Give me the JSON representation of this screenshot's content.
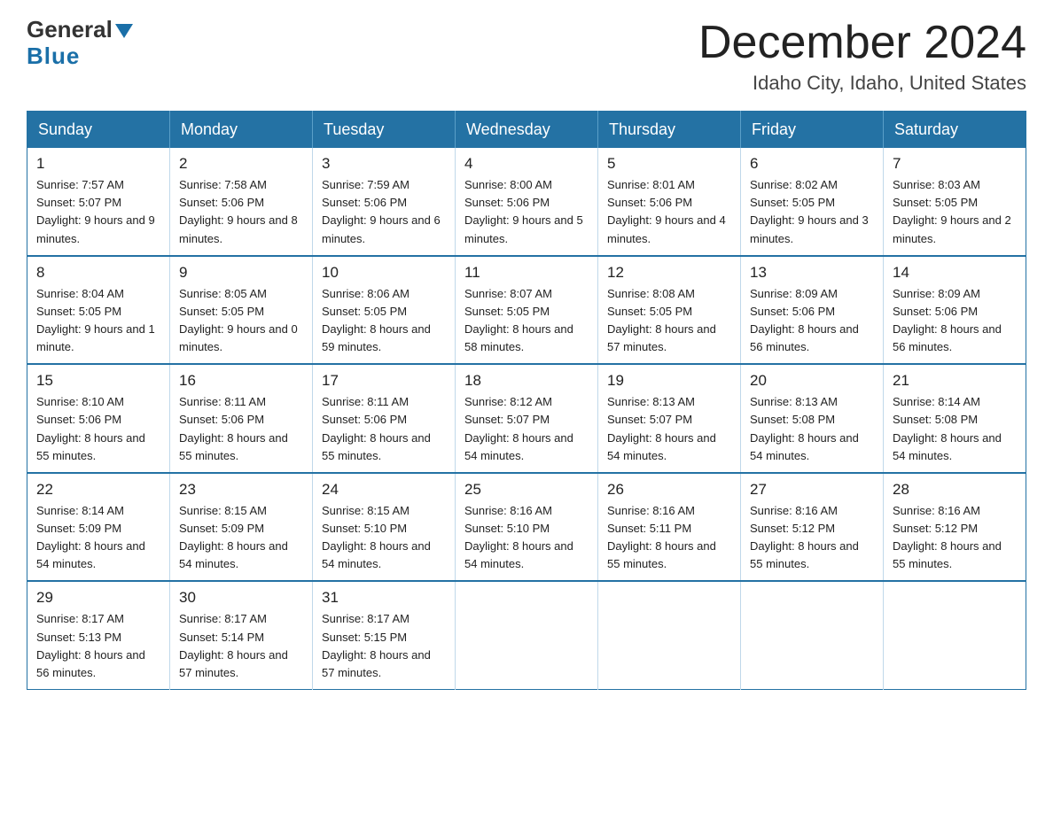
{
  "logo": {
    "general": "General",
    "blue": "Blue"
  },
  "header": {
    "title": "December 2024",
    "subtitle": "Idaho City, Idaho, United States"
  },
  "weekdays": [
    "Sunday",
    "Monday",
    "Tuesday",
    "Wednesday",
    "Thursday",
    "Friday",
    "Saturday"
  ],
  "weeks": [
    [
      {
        "day": "1",
        "sunrise": "7:57 AM",
        "sunset": "5:07 PM",
        "daylight": "9 hours and 9 minutes."
      },
      {
        "day": "2",
        "sunrise": "7:58 AM",
        "sunset": "5:06 PM",
        "daylight": "9 hours and 8 minutes."
      },
      {
        "day": "3",
        "sunrise": "7:59 AM",
        "sunset": "5:06 PM",
        "daylight": "9 hours and 6 minutes."
      },
      {
        "day": "4",
        "sunrise": "8:00 AM",
        "sunset": "5:06 PM",
        "daylight": "9 hours and 5 minutes."
      },
      {
        "day": "5",
        "sunrise": "8:01 AM",
        "sunset": "5:06 PM",
        "daylight": "9 hours and 4 minutes."
      },
      {
        "day": "6",
        "sunrise": "8:02 AM",
        "sunset": "5:05 PM",
        "daylight": "9 hours and 3 minutes."
      },
      {
        "day": "7",
        "sunrise": "8:03 AM",
        "sunset": "5:05 PM",
        "daylight": "9 hours and 2 minutes."
      }
    ],
    [
      {
        "day": "8",
        "sunrise": "8:04 AM",
        "sunset": "5:05 PM",
        "daylight": "9 hours and 1 minute."
      },
      {
        "day": "9",
        "sunrise": "8:05 AM",
        "sunset": "5:05 PM",
        "daylight": "9 hours and 0 minutes."
      },
      {
        "day": "10",
        "sunrise": "8:06 AM",
        "sunset": "5:05 PM",
        "daylight": "8 hours and 59 minutes."
      },
      {
        "day": "11",
        "sunrise": "8:07 AM",
        "sunset": "5:05 PM",
        "daylight": "8 hours and 58 minutes."
      },
      {
        "day": "12",
        "sunrise": "8:08 AM",
        "sunset": "5:05 PM",
        "daylight": "8 hours and 57 minutes."
      },
      {
        "day": "13",
        "sunrise": "8:09 AM",
        "sunset": "5:06 PM",
        "daylight": "8 hours and 56 minutes."
      },
      {
        "day": "14",
        "sunrise": "8:09 AM",
        "sunset": "5:06 PM",
        "daylight": "8 hours and 56 minutes."
      }
    ],
    [
      {
        "day": "15",
        "sunrise": "8:10 AM",
        "sunset": "5:06 PM",
        "daylight": "8 hours and 55 minutes."
      },
      {
        "day": "16",
        "sunrise": "8:11 AM",
        "sunset": "5:06 PM",
        "daylight": "8 hours and 55 minutes."
      },
      {
        "day": "17",
        "sunrise": "8:11 AM",
        "sunset": "5:06 PM",
        "daylight": "8 hours and 55 minutes."
      },
      {
        "day": "18",
        "sunrise": "8:12 AM",
        "sunset": "5:07 PM",
        "daylight": "8 hours and 54 minutes."
      },
      {
        "day": "19",
        "sunrise": "8:13 AM",
        "sunset": "5:07 PM",
        "daylight": "8 hours and 54 minutes."
      },
      {
        "day": "20",
        "sunrise": "8:13 AM",
        "sunset": "5:08 PM",
        "daylight": "8 hours and 54 minutes."
      },
      {
        "day": "21",
        "sunrise": "8:14 AM",
        "sunset": "5:08 PM",
        "daylight": "8 hours and 54 minutes."
      }
    ],
    [
      {
        "day": "22",
        "sunrise": "8:14 AM",
        "sunset": "5:09 PM",
        "daylight": "8 hours and 54 minutes."
      },
      {
        "day": "23",
        "sunrise": "8:15 AM",
        "sunset": "5:09 PM",
        "daylight": "8 hours and 54 minutes."
      },
      {
        "day": "24",
        "sunrise": "8:15 AM",
        "sunset": "5:10 PM",
        "daylight": "8 hours and 54 minutes."
      },
      {
        "day": "25",
        "sunrise": "8:16 AM",
        "sunset": "5:10 PM",
        "daylight": "8 hours and 54 minutes."
      },
      {
        "day": "26",
        "sunrise": "8:16 AM",
        "sunset": "5:11 PM",
        "daylight": "8 hours and 55 minutes."
      },
      {
        "day": "27",
        "sunrise": "8:16 AM",
        "sunset": "5:12 PM",
        "daylight": "8 hours and 55 minutes."
      },
      {
        "day": "28",
        "sunrise": "8:16 AM",
        "sunset": "5:12 PM",
        "daylight": "8 hours and 55 minutes."
      }
    ],
    [
      {
        "day": "29",
        "sunrise": "8:17 AM",
        "sunset": "5:13 PM",
        "daylight": "8 hours and 56 minutes."
      },
      {
        "day": "30",
        "sunrise": "8:17 AM",
        "sunset": "5:14 PM",
        "daylight": "8 hours and 57 minutes."
      },
      {
        "day": "31",
        "sunrise": "8:17 AM",
        "sunset": "5:15 PM",
        "daylight": "8 hours and 57 minutes."
      },
      null,
      null,
      null,
      null
    ]
  ],
  "labels": {
    "sunrise": "Sunrise:",
    "sunset": "Sunset:",
    "daylight": "Daylight:"
  }
}
